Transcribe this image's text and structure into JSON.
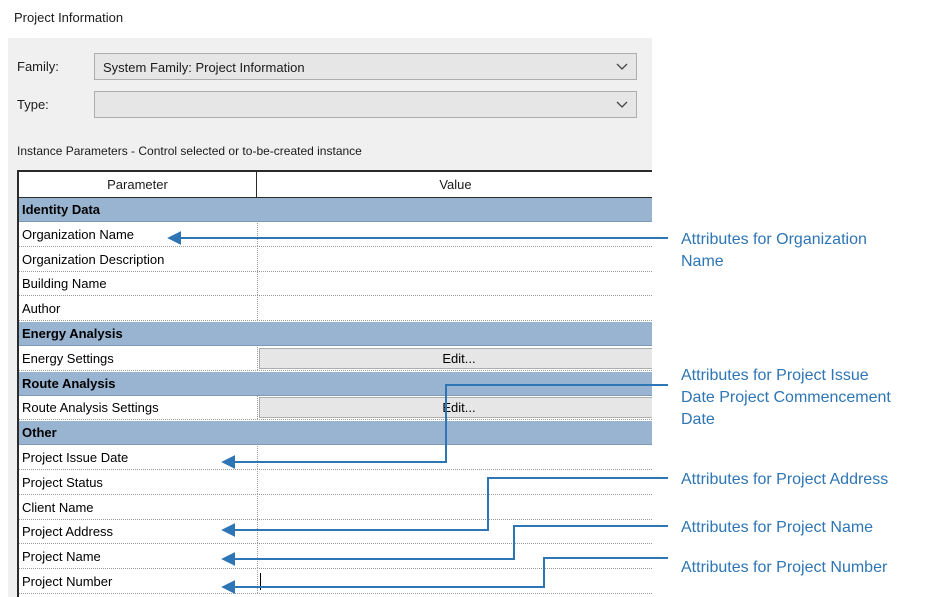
{
  "window": {
    "title": "Project Information"
  },
  "family": {
    "label": "Family:",
    "value": "System Family: Project Information"
  },
  "type": {
    "label": "Type:",
    "value": ""
  },
  "instance_caption": "Instance Parameters - Control selected or to-be-created instance",
  "table": {
    "headers": {
      "parameter": "Parameter",
      "value": "Value"
    },
    "rows": [
      {
        "kind": "group",
        "name": "Identity Data"
      },
      {
        "kind": "param",
        "name": "Organization Name"
      },
      {
        "kind": "param",
        "name": "Organization Description"
      },
      {
        "kind": "param",
        "name": "Building Name"
      },
      {
        "kind": "param",
        "name": "Author"
      },
      {
        "kind": "group",
        "name": "Energy Analysis"
      },
      {
        "kind": "param",
        "name": "Energy Settings",
        "button": "Edit..."
      },
      {
        "kind": "group",
        "name": "Route Analysis"
      },
      {
        "kind": "param",
        "name": "Route Analysis Settings",
        "button": "Edit..."
      },
      {
        "kind": "group",
        "name": "Other"
      },
      {
        "kind": "param",
        "name": "Project Issue Date"
      },
      {
        "kind": "param",
        "name": "Project Status"
      },
      {
        "kind": "param",
        "name": "Client Name"
      },
      {
        "kind": "param",
        "name": "Project Address"
      },
      {
        "kind": "param",
        "name": "Project Name"
      },
      {
        "kind": "param",
        "name": "Project Number"
      }
    ]
  },
  "annotations": {
    "org_line1": "Attributes  for Organization",
    "org_line2": "Name",
    "issue_line1": "Attributes  for Project Issue",
    "issue_line2": "Date Project Commencement",
    "issue_line3": "Date",
    "address": "Attributes  for Project Address",
    "name": "Attributes  for Project Name",
    "number": "Attributes  for Project Number"
  },
  "colors": {
    "group_row": "#99b4d1",
    "annotation": "#2e75b6",
    "panel": "#f0f0f0"
  },
  "icons": {
    "dropdown": "chevron-down-icon",
    "arrow": "arrow-left-icon"
  }
}
